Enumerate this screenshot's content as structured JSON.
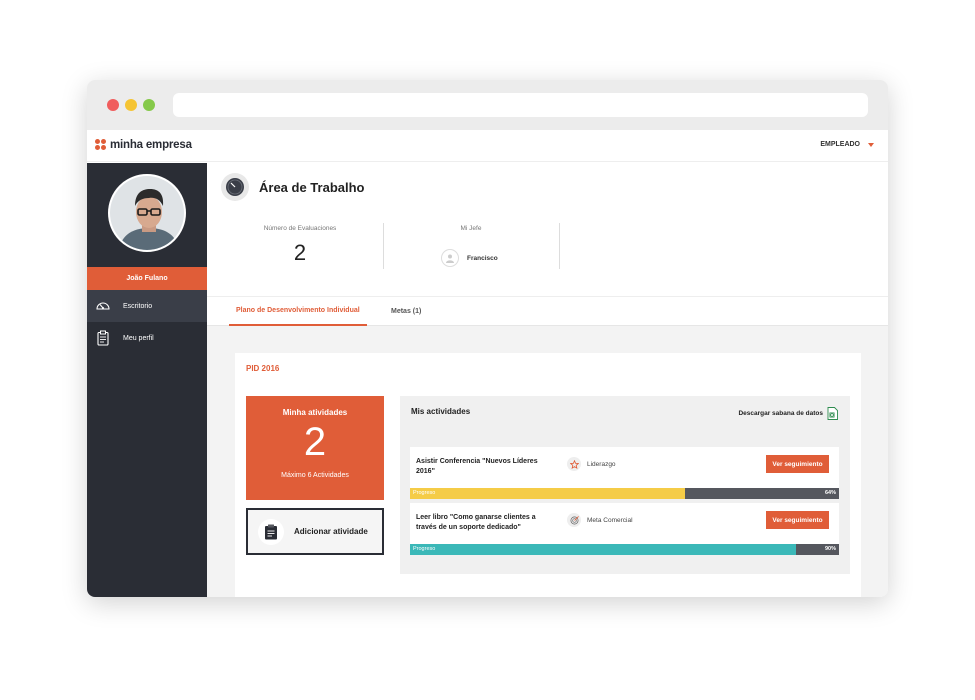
{
  "app": {
    "logo_text": "minha empresa",
    "user_menu_label": "EMPLEADO"
  },
  "colors": {
    "accent": "#e05d38",
    "sidebar": "#2a2d35",
    "progress_yellow": "#f5cc47",
    "progress_teal": "#3bb8b8",
    "progress_track": "#55575e"
  },
  "sidebar": {
    "user_name": "João Fulano",
    "items": [
      {
        "label": "Escritorio",
        "icon": "speedometer-icon",
        "active": true
      },
      {
        "label": "Meu perfil",
        "icon": "clipboard-icon",
        "active": false
      }
    ]
  },
  "header": {
    "title": "Área de Trabalho",
    "stats": {
      "evaluations_label": "Número de Evaluaciones",
      "evaluations_value": "2",
      "boss_label": "Mi Jefe",
      "boss_name": "Francisco"
    }
  },
  "tabs": [
    {
      "label": "Plano de Desenvolvimento Individual",
      "active": true
    },
    {
      "label": "Metas (1)",
      "active": false
    }
  ],
  "pid": {
    "title": "PID 2016",
    "count_label": "Minha atividades",
    "count_value": "2",
    "count_sub": "Máximo 6 Actividades",
    "add_label": "Adicionar atividade"
  },
  "activities": {
    "title": "Mis actividades",
    "download_label": "Descargar sabana de datos",
    "items": [
      {
        "name": "Asistir Conferencia \"Nuevos Líderes 2016\"",
        "category": "Liderazgo",
        "category_icon": "star-badge-icon",
        "button_label": "Ver seguimiento",
        "progress_label": "Progreso",
        "progress": 64,
        "progress_text": "64%",
        "color": "#f5cc47"
      },
      {
        "name": "Leer libro \"Como ganarse clientes a través de un soporte dedicado\"",
        "category": "Meta Comercial",
        "category_icon": "target-icon",
        "button_label": "Ver seguimiento",
        "progress_label": "Progreso",
        "progress": 90,
        "progress_text": "90%",
        "color": "#3bb8b8"
      }
    ]
  }
}
